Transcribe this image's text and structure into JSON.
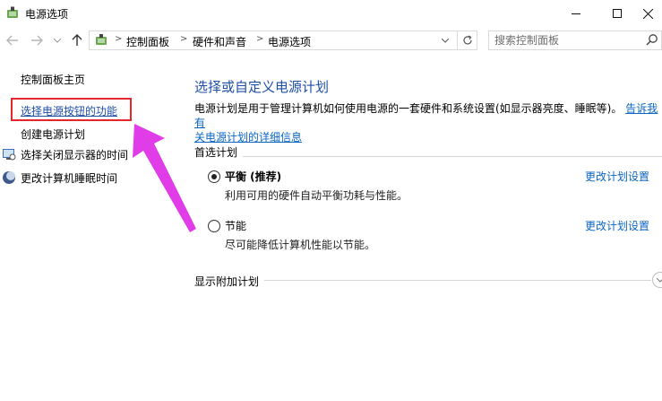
{
  "window": {
    "title": "电源选项",
    "icon": "power-options-icon"
  },
  "address_bar": {
    "breadcrumbs": [
      "控制面板",
      "硬件和声音",
      "电源选项"
    ]
  },
  "search": {
    "placeholder": "搜索控制面板"
  },
  "sidebar": {
    "home": "控制面板主页",
    "items": [
      {
        "label": "选择电源按钮的功能",
        "icon": null
      },
      {
        "label": "创建电源计划",
        "icon": null
      },
      {
        "label": "选择关闭显示器的时间",
        "icon": "display-icon"
      },
      {
        "label": "更改计算机睡眠时间",
        "icon": "moon-icon"
      }
    ]
  },
  "main": {
    "title": "选择或自定义电源计划",
    "description": "电源计划是用于管理计算机如何使用电源的一套硬件和系统设置(如显示器亮度、睡眠等)。",
    "description_link": "告诉我有关电源计划的详细信息",
    "description_link_line1": "告诉我有",
    "description_link_line2": "关电源计划的详细信息",
    "preferred_section": "首选计划",
    "plans": [
      {
        "name": "平衡 (推荐)",
        "description": "利用可用的硬件自动平衡功耗与性能。",
        "link": "更改计划设置",
        "selected": true
      },
      {
        "name": "节能",
        "description": "尽可能降低计算机性能以节能。",
        "link": "更改计划设置",
        "selected": false
      }
    ],
    "additional_section": "显示附加计划"
  },
  "colors": {
    "title_blue": "#1e4fa8",
    "link_blue": "#0b66c2",
    "highlight_red": "#e5262b",
    "arrow_magenta": "#e03ce8"
  }
}
